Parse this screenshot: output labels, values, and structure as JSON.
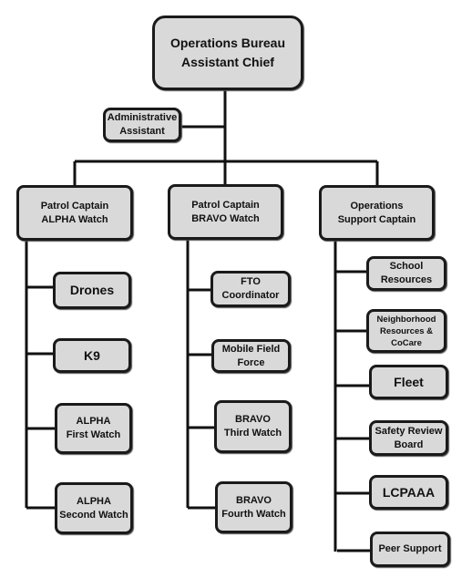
{
  "chief": "Operations Bureau\nAssistant Chief",
  "admin": "Administrative\nAssistant",
  "captains": [
    {
      "label": "Patrol Captain\nALPHA Watch",
      "units": [
        "Drones",
        "K9",
        "ALPHA\nFirst Watch",
        "ALPHA\nSecond Watch"
      ]
    },
    {
      "label": "Patrol Captain\nBRAVO Watch",
      "units": [
        "FTO\nCoordinator",
        "Mobile Field\nForce",
        "BRAVO\nThird Watch",
        "BRAVO\nFourth Watch"
      ]
    },
    {
      "label": "Operations\nSupport Captain",
      "units": [
        "School\nResources",
        "Neighborhood\nResources &\nCoCare",
        "Fleet",
        "Safety Review\nBoard",
        "LCPAAA",
        "Peer Support"
      ]
    }
  ],
  "colors": {
    "box_fill": "#d9d9d9",
    "line": "#111111"
  }
}
